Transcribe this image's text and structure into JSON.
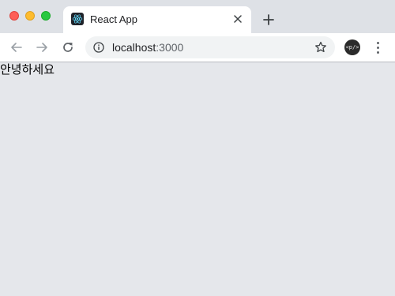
{
  "window": {
    "traffic_lights": [
      "close",
      "minimize",
      "maximize"
    ]
  },
  "tab": {
    "title": "React App",
    "favicon": "react-logo-icon",
    "close_icon": "close-icon"
  },
  "new_tab_icon": "plus-icon",
  "toolbar": {
    "back_icon": "arrow-left-icon",
    "forward_icon": "arrow-right-icon",
    "reload_icon": "reload-icon",
    "info_icon": "info-icon",
    "url_host": "localhost",
    "url_port": ":3000",
    "bookmark_icon": "star-icon",
    "extension_label": "<p/>",
    "menu_icon": "kebab-menu-icon"
  },
  "page": {
    "greeting": "안녕하세요"
  },
  "colors": {
    "page_background": "#e5e7eb",
    "tabstrip_background": "#dee1e6",
    "omnibox_background": "#f1f3f4"
  }
}
